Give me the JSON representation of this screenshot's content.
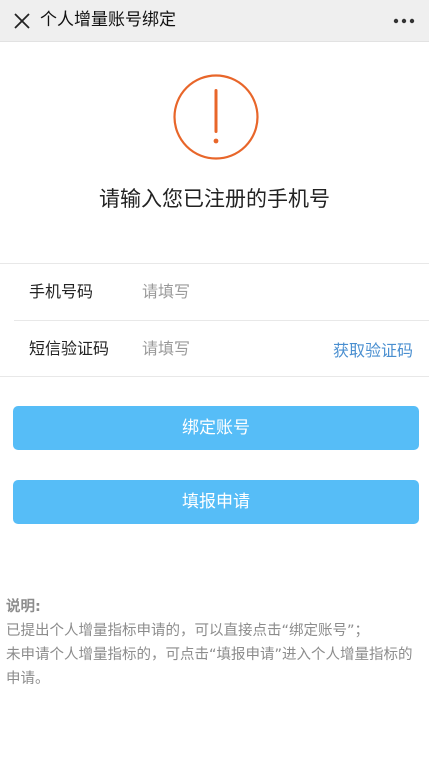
{
  "header": {
    "title": "个人增量账号绑定",
    "close_icon": "close-icon",
    "more_icon": "more-icon"
  },
  "alert": {
    "icon": "exclamation-circle-icon",
    "color": "#e8662a",
    "message": "请输入您已注册的手机号"
  },
  "form": {
    "phone": {
      "label": "手机号码",
      "placeholder": "请填写"
    },
    "sms": {
      "label": "短信验证码",
      "placeholder": "请填写",
      "get_code": "获取验证码"
    }
  },
  "buttons": {
    "bind": "绑定账号",
    "apply": "填报申请"
  },
  "note": {
    "title": "说明:",
    "line1": "已提出个人增量指标申请的，可以直接点击“绑定账号”；",
    "line2": "未申请个人增量指标的，可点击“填报申请”进入个人增量指标的申请。"
  },
  "colors": {
    "accent": "#56bdf7",
    "link": "#4a8fd0",
    "alert": "#e8662a"
  }
}
